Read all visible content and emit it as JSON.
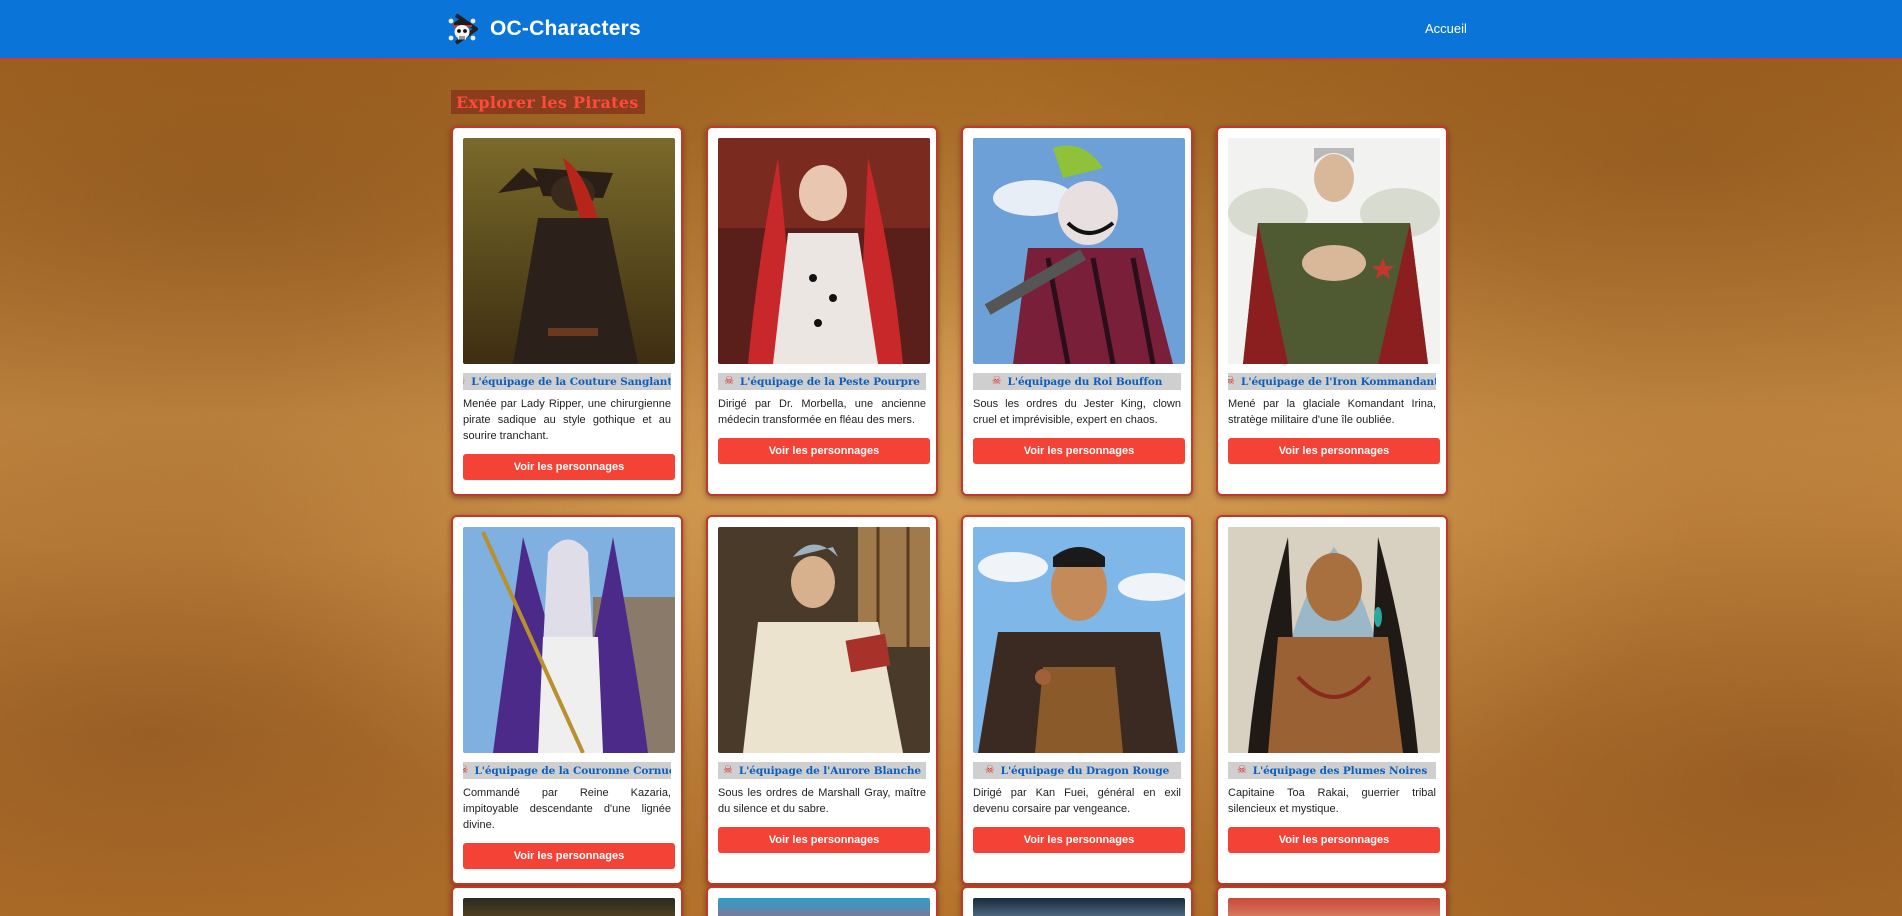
{
  "header": {
    "brand": "OC-Characters",
    "brand_icon": "skull-crossbones-icon",
    "nav": [
      {
        "label": "Accueil"
      }
    ],
    "bg_color": "#0a74d8"
  },
  "main": {
    "section_title": "Explorer les Pirates",
    "button_label": "Voir les personnages",
    "cards": [
      {
        "title": "L'équipage de la Couture Sanglante",
        "description": "Menée par Lady Ripper, une chirurgienne pirate sadique au style gothique et au sourire tranchant."
      },
      {
        "title": "L'équipage de la Peste Pourpre",
        "description": "Dirigé par Dr. Morbella, une ancienne médecin transformée en fléau des mers."
      },
      {
        "title": "L'équipage du Roi Bouffon",
        "description": "Sous les ordres du Jester King, clown cruel et imprévisible, expert en chaos."
      },
      {
        "title": "L'équipage de l'Iron Kommandant",
        "description": "Mené par la glaciale Komandant Irina, stratège militaire d'une île oubliée."
      },
      {
        "title": "L'équipage de la Couronne Cornue",
        "description": "Commandé par Reine Kazaria, impitoyable descendante d'une lignée divine."
      },
      {
        "title": "L'équipage de l'Aurore Blanche",
        "description": "Sous les ordres de Marshall Gray, maître du silence et du sabre."
      },
      {
        "title": "L'équipage du Dragon Rouge",
        "description": "Dirigé par Kan Fuei, général en exil devenu corsaire par vengeance."
      },
      {
        "title": "L'équipage des Plumes Noires",
        "description": "Capitaine Toa Rakai, guerrier tribal silencieux et mystique."
      }
    ]
  },
  "colors": {
    "accent": "#f44336",
    "title_blue": "#0a5fbf",
    "section_title_red": "#ff4a3c"
  }
}
